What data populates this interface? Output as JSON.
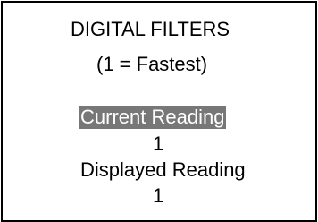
{
  "screen": {
    "title": "DIGITAL FILTERS",
    "subtitle": "(1 = Fastest)",
    "current_reading": {
      "label": "Current Reading",
      "value": "1",
      "selected": true
    },
    "displayed_reading": {
      "label": "Displayed Reading",
      "value": "1"
    }
  },
  "colors": {
    "highlight_background": "#777777",
    "highlight_text": "#ffffff",
    "text": "#000000",
    "border": "#000000",
    "background": "#ffffff"
  }
}
